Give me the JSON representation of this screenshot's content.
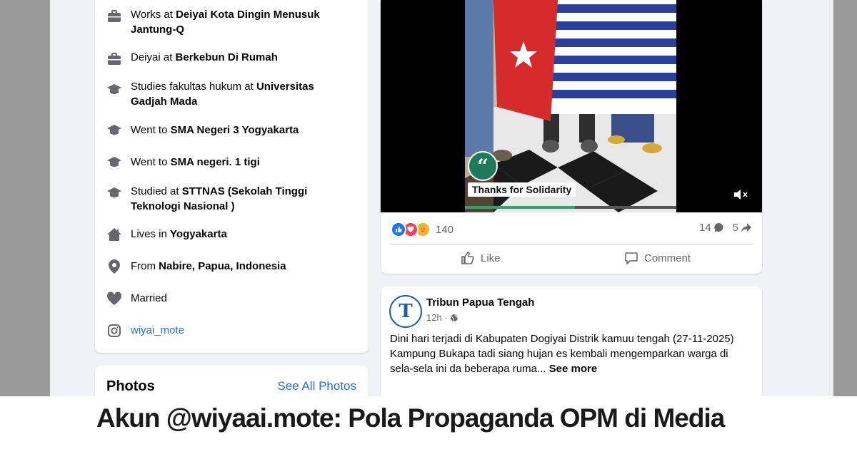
{
  "intro": {
    "items": [
      {
        "icon": "briefcase-icon",
        "prefix": "Works at ",
        "bold": "Deiyai Kota Dingin Menusuk Jantung-Q"
      },
      {
        "icon": "briefcase-icon",
        "prefix": "Deiyai at ",
        "bold": "Berkebun Di Rumah"
      },
      {
        "icon": "graduation-cap-icon",
        "prefix": "Studies fakultas hukum at ",
        "bold": "Universitas Gadjah Mada"
      },
      {
        "icon": "graduation-cap-icon",
        "prefix": "Went to ",
        "bold": "SMA Negeri 3 Yogyakarta"
      },
      {
        "icon": "graduation-cap-icon",
        "prefix": "Went to ",
        "bold": "SMA negeri. 1 tigi"
      },
      {
        "icon": "graduation-cap-icon",
        "prefix": "Studied at ",
        "bold": "STTNAS (Sekolah Tinggi Teknologi Nasional )"
      },
      {
        "icon": "home-icon",
        "prefix": "Lives in ",
        "bold": "Yogyakarta"
      },
      {
        "icon": "location-pin-icon",
        "prefix": "From ",
        "bold": "Nabire, Papua, Indonesia"
      },
      {
        "icon": "heart-icon",
        "prefix": "Married",
        "bold": ""
      },
      {
        "icon": "instagram-icon",
        "prefix": "wiyai_mote",
        "bold": ""
      }
    ]
  },
  "photos": {
    "title": "Photos",
    "see_all": "See All Photos"
  },
  "post": {
    "video_caption": "Thanks for Solidarity",
    "video_progress": 0.52,
    "reaction_count": "140",
    "comment_count": "14",
    "share_count": "5",
    "like_label": "Like",
    "comment_label": "Comment"
  },
  "news_post": {
    "author": "Tribun Papua Tengah",
    "time": "12h ·",
    "body": "Dini hari terjadi di Kabupaten Dogiyai Distrik kamuu tengah (27-11-2025) Kampung Bukapa tadi siang hujan es kembali mengemparkan warga di sela-sela ini da beberapa ruma...",
    "see_more": "See more"
  },
  "headline": "Akun @wiyaai.mote: Pola Propaganda OPM di Media",
  "colors": {
    "link": "#216fdb",
    "like_blue": "#1877f2",
    "love_red": "#f33e58",
    "care_yellow": "#f7b125"
  }
}
